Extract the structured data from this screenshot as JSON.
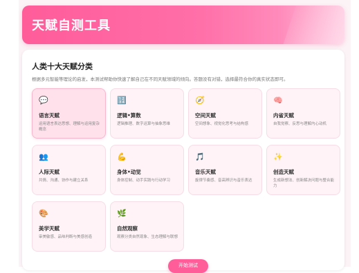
{
  "header": {
    "title": "天赋自测工具"
  },
  "section": {
    "title": "人类十大天赋分类",
    "description": "根据多元智能等理论的启发，本测试帮助你快速了解自己在不同天赋领域的倾向。答题没有对错，选择最符合你的真实状态即可。"
  },
  "categories": [
    {
      "name": "语言天赋",
      "desc": "运用语言表达思想、理解与运用复杂概念",
      "icon": "speech-bubble-icon",
      "glyph": "💬"
    },
    {
      "name": "逻辑•算数",
      "desc": "逻辑推理、数字运算与抽象思维",
      "icon": "numbers-icon",
      "glyph": "🔢"
    },
    {
      "name": "空间天赋",
      "desc": "空间想象、视觉化思考与结构感",
      "icon": "compass-icon",
      "glyph": "🧭"
    },
    {
      "name": "内省天赋",
      "desc": "自我觉察、反思与理解内心动机",
      "icon": "brain-icon",
      "glyph": "🧠"
    },
    {
      "name": "人际天赋",
      "desc": "共情、沟通、协作与建立关系",
      "icon": "people-icon",
      "glyph": "👥"
    },
    {
      "name": "身体•动觉",
      "desc": "身体控制、动手实践与行动学习",
      "icon": "flexed-arm-icon",
      "glyph": "💪"
    },
    {
      "name": "音乐天赋",
      "desc": "旋律节奏感、音高辨识与音乐表达",
      "icon": "music-note-icon",
      "glyph": "🎵"
    },
    {
      "name": "创造天赋",
      "desc": "生成新想法、创新解决问题与整合能力",
      "icon": "sparkles-icon",
      "glyph": "✨"
    },
    {
      "name": "美学天赋",
      "desc": "审美敏感、品味判断与美感创造",
      "icon": "palette-icon",
      "glyph": "🎨"
    },
    {
      "name": "自然观察",
      "desc": "观察分类自然现象、生态理解与联想",
      "icon": "herb-icon",
      "glyph": "🌿"
    }
  ],
  "actions": {
    "start_label": "开始测试"
  },
  "colors": {
    "accent": "#ff5c9a",
    "card_bg": "#fff3f7",
    "selected_bg": "#ffe1ec"
  }
}
